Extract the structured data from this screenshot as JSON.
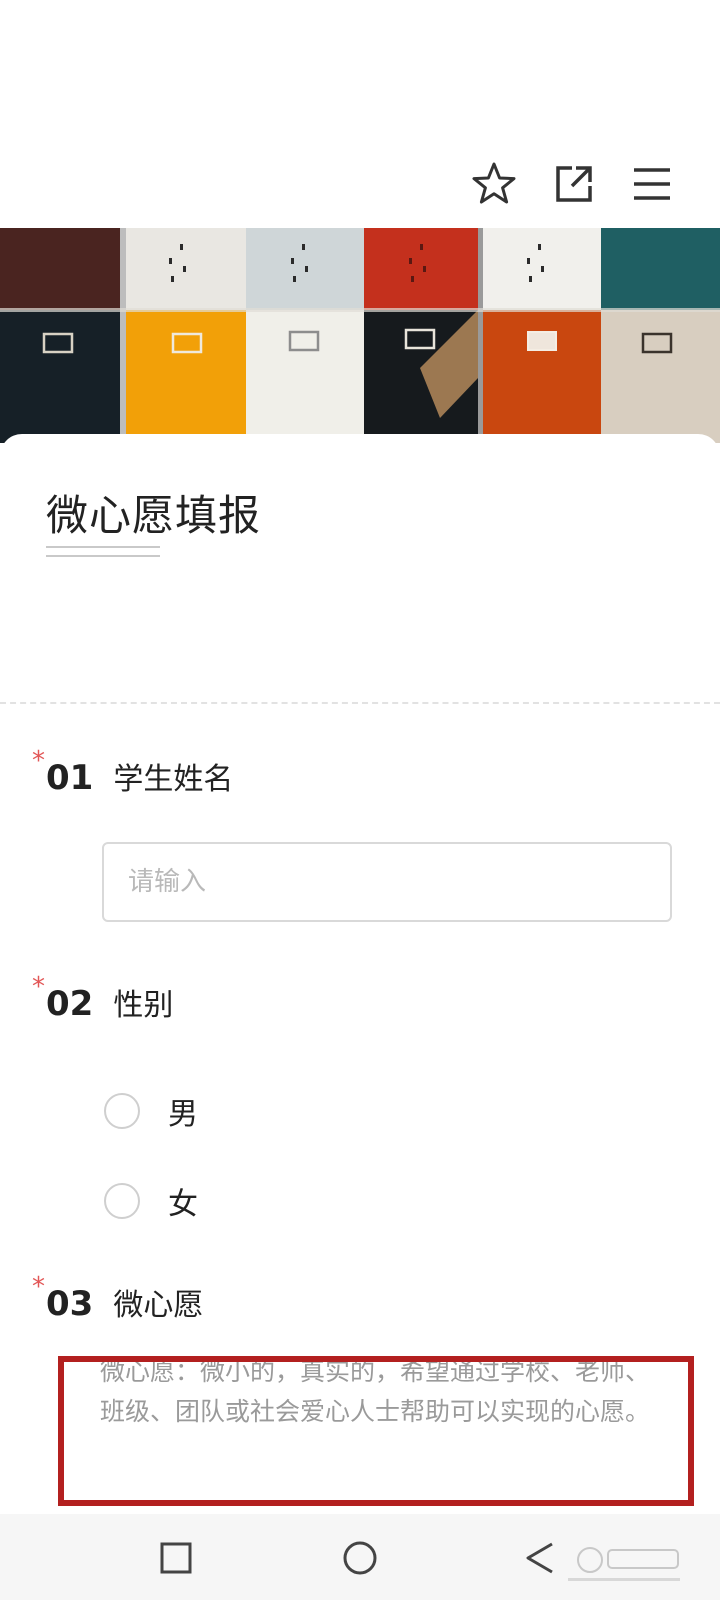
{
  "toolbar": {
    "icons": [
      "star-icon",
      "share-icon",
      "menu-icon"
    ]
  },
  "form": {
    "title": "微心愿填报",
    "questions": [
      {
        "required_mark": "*",
        "number": "01",
        "label": "学生姓名",
        "placeholder": "请输入"
      },
      {
        "required_mark": "*",
        "number": "02",
        "label": "性别",
        "options": [
          "男",
          "女"
        ]
      },
      {
        "required_mark": "*",
        "number": "03",
        "label": "微心愿",
        "description": "微心愿：微小的，真实的，希望通过学校、老师、班级、团队或社会爱心人士帮助可以实现的心愿。"
      }
    ]
  },
  "nav": {
    "icons": [
      "recent-apps-icon",
      "home-icon",
      "back-icon"
    ]
  },
  "colors": {
    "required": "#e25757",
    "highlight_box": "#b3201f"
  }
}
